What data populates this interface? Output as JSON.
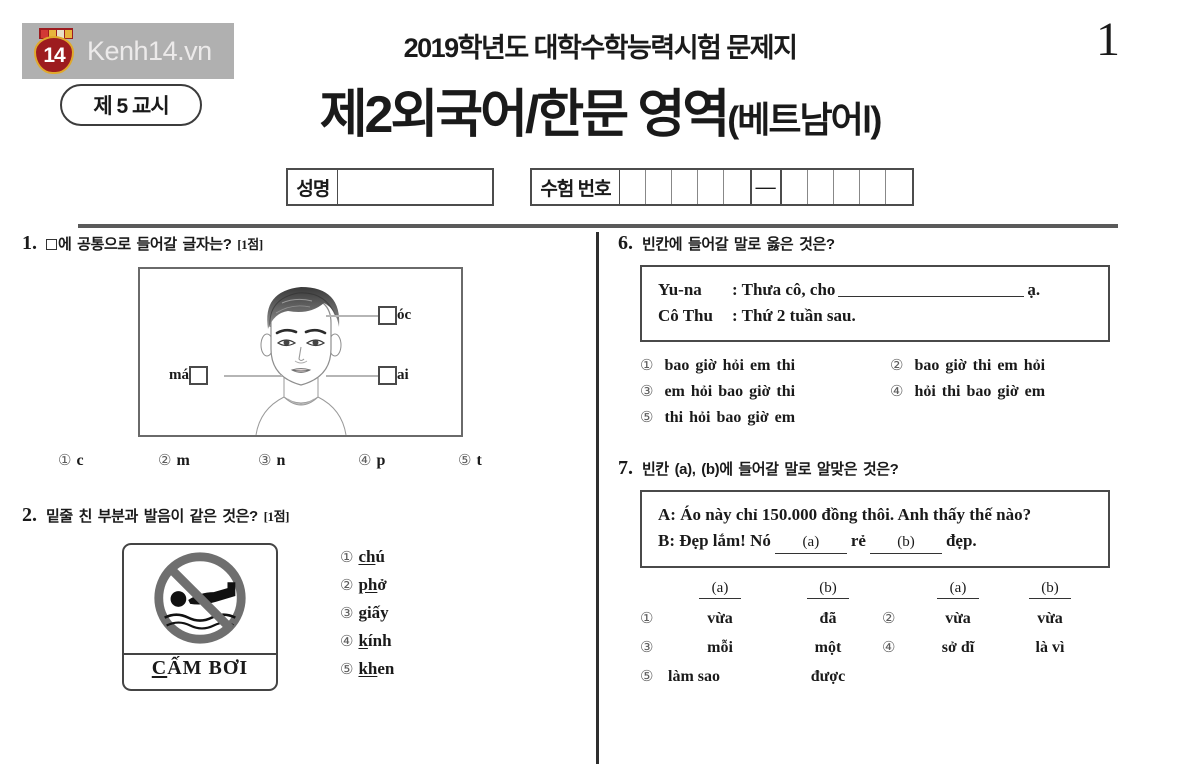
{
  "watermark": {
    "brand_text": "Kenh14.vn",
    "logo_number": "14"
  },
  "header": {
    "period_badge": "제 5 교시",
    "exam_year_line": "2019학년도 대학수학능력시험 문제지",
    "title_main": "제2외국어/한문 영역",
    "title_paren": "(베트남어Ⅰ)",
    "page_number": "1"
  },
  "id_row": {
    "name_label": "성명",
    "exam_number_label": "수험 번호",
    "dash": "—",
    "left_digits": 5,
    "right_digits": 5
  },
  "questions": [
    {
      "number": "1.",
      "prompt_before_box": "",
      "prompt": "에 공통으로 들어갈 글자는?",
      "points": "[1점]",
      "figure": {
        "label_top_right": "óc",
        "label_bottom_right": "ai",
        "label_left": "má",
        "description": "face-diagram"
      },
      "options": [
        {
          "mark": "①",
          "text": "c"
        },
        {
          "mark": "②",
          "text": "m"
        },
        {
          "mark": "③",
          "text": "n"
        },
        {
          "mark": "④",
          "text": "p"
        },
        {
          "mark": "⑤",
          "text": "t"
        }
      ]
    },
    {
      "number": "2.",
      "prompt": "밑줄 친 부분과 발음이 같은 것은?",
      "points": "[1점]",
      "sign": {
        "caption_underlined": "C",
        "caption_rest": "ẤM BƠI"
      },
      "options": [
        {
          "mark": "①",
          "underlined": "ch",
          "rest": "ú"
        },
        {
          "mark": "②",
          "underlined": "ph",
          "rest": "ở"
        },
        {
          "mark": "③",
          "underlined": "g",
          "rest": "iấy"
        },
        {
          "mark": "④",
          "underlined": "k",
          "rest": "ính"
        },
        {
          "mark": "⑤",
          "underlined": "kh",
          "rest": "en"
        }
      ]
    },
    {
      "number": "6.",
      "prompt": "빈칸에 들어갈 말로 옳은 것은?",
      "dialogue": [
        {
          "speaker": "Yu-na",
          "before": "Thưa cô, cho",
          "after": "ạ."
        },
        {
          "speaker": "Cô Thu",
          "text": "Thứ 2 tuần sau."
        }
      ],
      "options": [
        {
          "mark": "①",
          "text": "bao giờ hỏi em thi"
        },
        {
          "mark": "②",
          "text": "bao giờ thi em hỏi"
        },
        {
          "mark": "③",
          "text": "em hỏi bao giờ thi"
        },
        {
          "mark": "④",
          "text": "hỏi thi bao giờ em"
        },
        {
          "mark": "⑤",
          "text": "thi hỏi bao giờ em"
        }
      ]
    },
    {
      "number": "7.",
      "prompt": "빈칸 (a), (b)에 들어갈 말로 알맞은 것은?",
      "dialogue": [
        {
          "speaker": "A",
          "text": "Áo này chỉ 150.000 đồng thôi. Anh thấy thế nào?"
        },
        {
          "speaker": "B",
          "before": "Đẹp lắm! Nó",
          "blank_a": "(a)",
          "middle": "rẻ",
          "blank_b": "(b)",
          "after": "đẹp."
        }
      ],
      "col_header_a": "(a)",
      "col_header_b": "(b)",
      "options": [
        {
          "mark": "①",
          "a": "vừa",
          "b": "đã"
        },
        {
          "mark": "②",
          "a": "vừa",
          "b": "vừa"
        },
        {
          "mark": "③",
          "a": "mỗi",
          "b": "một"
        },
        {
          "mark": "④",
          "a": "sở dĩ",
          "b": "là vì"
        },
        {
          "mark": "⑤",
          "a": "làm sao",
          "b": "được"
        }
      ]
    }
  ]
}
